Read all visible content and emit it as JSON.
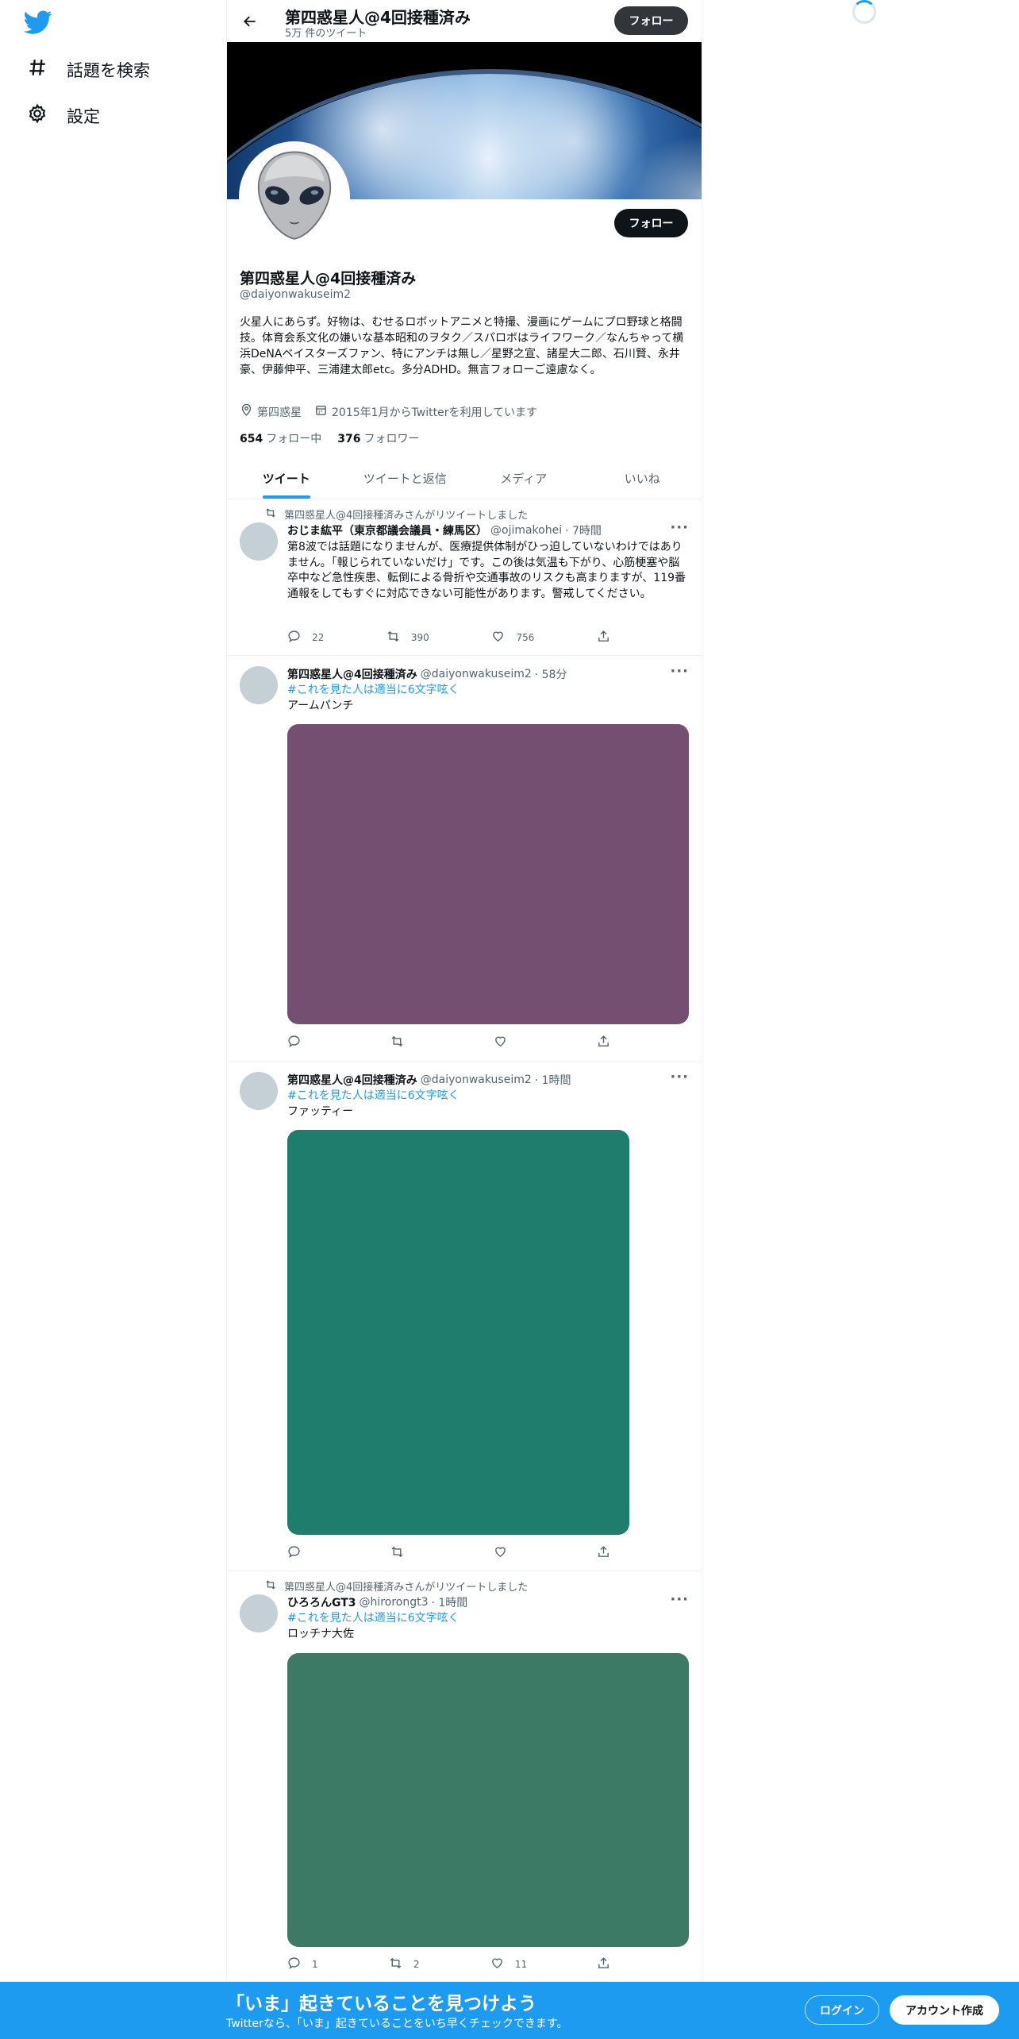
{
  "sidebar": {
    "items": [
      {
        "label": "話題を検索",
        "icon": "hashtag-icon"
      },
      {
        "label": "設定",
        "icon": "gear-icon"
      }
    ]
  },
  "header": {
    "title": "第四惑星人@4回接種済み",
    "subtitle": "5万 件のツイート",
    "follow_label": "フォロー"
  },
  "profile": {
    "name": "第四惑星人@4回接種済み",
    "handle": "@daiyonwakuseim2",
    "bio": "火星人にあらず。好物は、むせるロボットアニメと特撮、漫画にゲームにプロ野球と格闘技。体育会系文化の嫌いな基本昭和のヲタク／スパロボはライフワーク／なんちゃって横浜DeNAベイスターズファン、特にアンチは無し／星野之宣、諸星大二郎、石川賢、永井豪、伊藤伸平、三浦建太郎etc。多分ADHD。無言フォローご遠慮なく。",
    "location": "第四惑星",
    "joined": "2015年1月からTwitterを利用しています",
    "following_count": "654",
    "following_label": "フォロー中",
    "followers_count": "376",
    "followers_label": "フォロワー",
    "follow_label": "フォロー"
  },
  "tabs": [
    {
      "label": "ツイート",
      "active": true
    },
    {
      "label": "ツイートと返信",
      "active": false
    },
    {
      "label": "メディア",
      "active": false
    },
    {
      "label": "いいね",
      "active": false
    }
  ],
  "tweets": [
    {
      "retweet_note": "第四惑星人@4回接種済みさんがリツイートしました",
      "name": "おじま紘平（東京都議会議員・練馬区）",
      "handle": "@ojimakohei",
      "time": "· 7時間",
      "text": "第8波では話題になりませんが、医療提供体制がひっ迫していないわけではありません。「報じられていないだけ」です。この後は気温も下がり、心筋梗塞や脳卒中など急性疾患、転倒による骨折や交通事故のリスクも高まりますが、119番通報をしてもすぐに対応できない可能性があります。警戒してください。",
      "replies": "22",
      "retweets": "390",
      "likes": "756"
    },
    {
      "name": "第四惑星人@4回接種済み",
      "handle": "@daiyonwakuseim2",
      "time": "· 58分",
      "hashtag": "#これを見た人は適当に6文字呟く",
      "text": "アームパンチ",
      "media_color": "#744f71",
      "replies": "",
      "retweets": "",
      "likes": ""
    },
    {
      "name": "第四惑星人@4回接種済み",
      "handle": "@daiyonwakuseim2",
      "time": "· 1時間",
      "hashtag": "#これを見た人は適当に6文字呟く",
      "text": "ファッティー",
      "media_color": "#1f7d6d",
      "replies": "",
      "retweets": "",
      "likes": ""
    },
    {
      "retweet_note": "第四惑星人@4回接種済みさんがリツイートしました",
      "name": "ひろろんGT3",
      "handle": "@hirorongt3",
      "time": "· 1時間",
      "hashtag": "#これを見た人は適当に6文字呟く",
      "text": "ロッチナ大佐",
      "media_color": "#3d7a65",
      "replies": "1",
      "retweets": "2",
      "likes": "11"
    }
  ],
  "bottom": {
    "title": "「いま」起きていることを見つけよう",
    "subtitle": "Twitterなら、「いま」起きていることをいち早くチェックできます。",
    "login_label": "ログイン",
    "signup_label": "アカウント作成"
  },
  "colors": {
    "accent": "#1d9bf0",
    "text": "#0f1419",
    "muted": "#536471"
  }
}
